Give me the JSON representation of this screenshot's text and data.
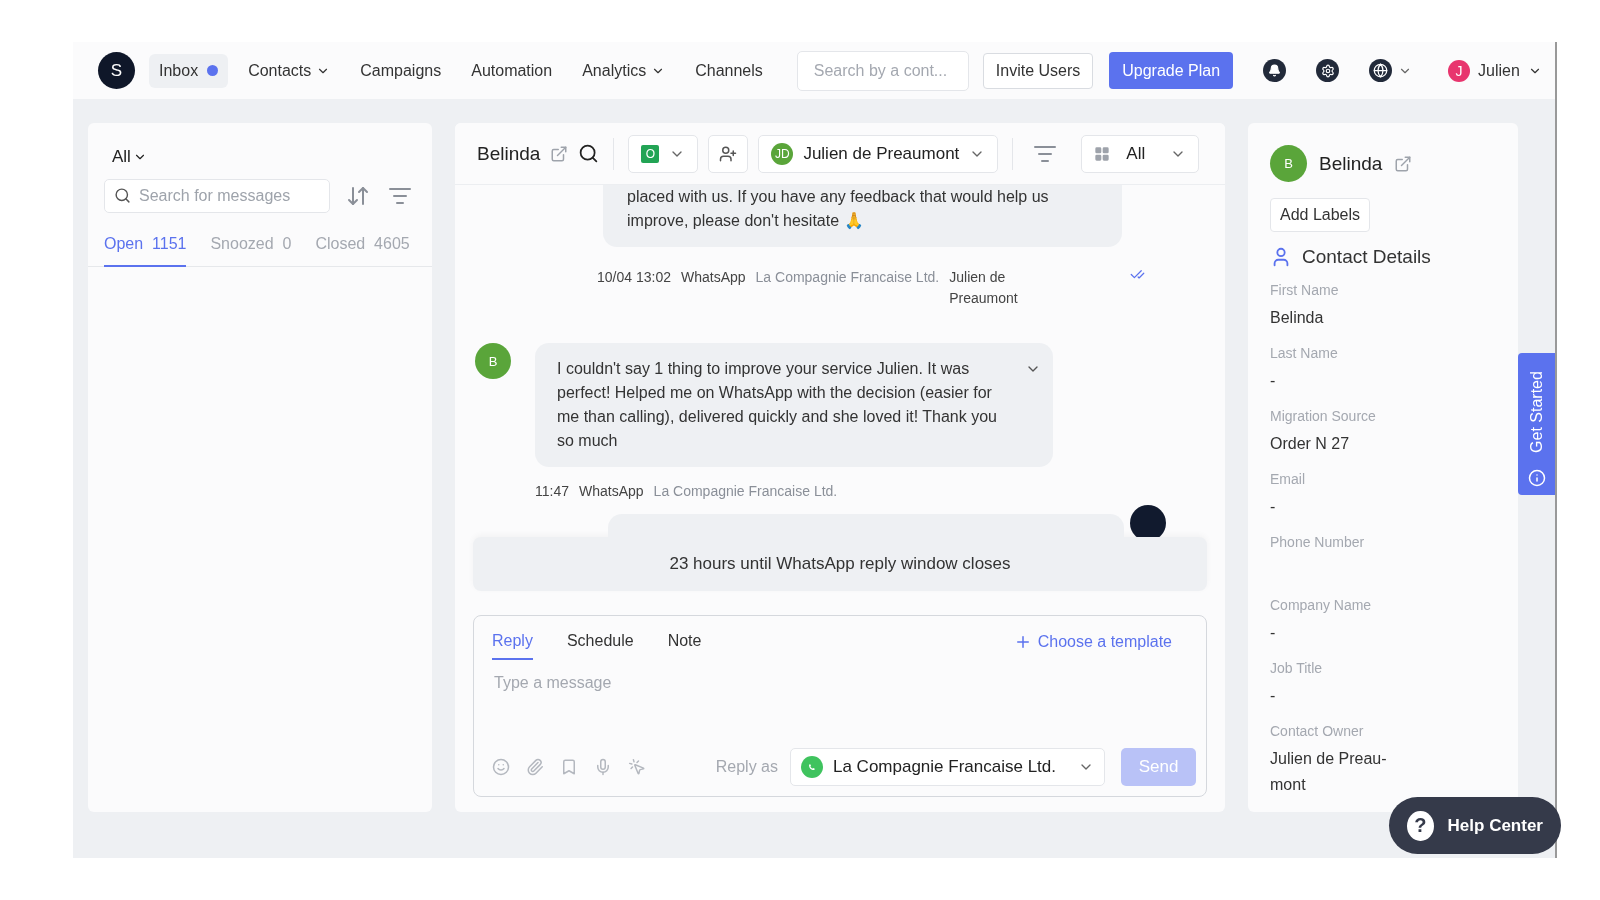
{
  "nav": {
    "logo": "S",
    "items": [
      {
        "label": "Inbox",
        "selected": true,
        "dot": true,
        "dropdown": false
      },
      {
        "label": "Contacts",
        "selected": false,
        "dot": false,
        "dropdown": true
      },
      {
        "label": "Campaigns",
        "selected": false,
        "dot": false,
        "dropdown": false
      },
      {
        "label": "Automation",
        "selected": false,
        "dot": false,
        "dropdown": false
      },
      {
        "label": "Analytics",
        "selected": false,
        "dot": false,
        "dropdown": true
      },
      {
        "label": "Channels",
        "selected": false,
        "dot": false,
        "dropdown": false
      }
    ],
    "search": {
      "placeholder": "Search by a cont..."
    },
    "invite": "Invite Users",
    "upgrade": "Upgrade Plan",
    "user": {
      "initial": "J",
      "name": "Julien"
    }
  },
  "inbox": {
    "filter": "All",
    "search": {
      "placeholder": "Search for messages"
    },
    "tabs": [
      {
        "label": "Open",
        "count": "1151",
        "selected": true
      },
      {
        "label": "Snoozed",
        "count": "0",
        "selected": false
      },
      {
        "label": "Closed",
        "count": "4605",
        "selected": false
      }
    ]
  },
  "conversation": {
    "contact": "Belinda",
    "status_badge": "O",
    "assignee": {
      "initials": "JD",
      "name": "Julien de Preaumont"
    },
    "view": "All",
    "messages": [
      {
        "kind": "outgoing",
        "text": "placed with us. If you have any feedback that would help us improve, please don't hesitate 🙏",
        "time": "10/04 13:02",
        "channel": "WhatsApp",
        "account": "La Compagnie Francaise Ltd.",
        "agent": "Julien de Preaumont",
        "read": true
      },
      {
        "kind": "incoming",
        "avatar": "B",
        "text": "I couldn't say 1 thing to improve your service Julien. It was perfect! Helped me on WhatsApp with the decision (easier for me than calling), delivered quickly and she loved it! Thank you so much",
        "time": "11:47",
        "channel": "WhatsApp",
        "account": "La Compagnie Francaise Ltd."
      },
      {
        "kind": "outgoing-hidden"
      }
    ],
    "banner": "23 hours until WhatsApp reply window closes",
    "composer": {
      "tabs": [
        {
          "label": "Reply",
          "selected": true
        },
        {
          "label": "Schedule",
          "selected": false
        },
        {
          "label": "Note",
          "selected": false
        }
      ],
      "template": "Choose a template",
      "placeholder": "Type a message",
      "reply_as_label": "Reply as",
      "reply_as": "La Compagnie Francaise Ltd.",
      "send": "Send",
      "send_disabled": true
    }
  },
  "contact": {
    "avatar": "B",
    "name": "Belinda",
    "add_labels": "Add Labels",
    "section": "Contact Details",
    "fields": [
      {
        "label": "First Name",
        "value": "Belinda"
      },
      {
        "label": "Last Name",
        "value": "-"
      },
      {
        "label": "Migration Source",
        "value": "Order N 27"
      },
      {
        "label": "Email",
        "value": "-"
      },
      {
        "label": "Phone Number"
      },
      {
        "label": "Company Name",
        "value": "-"
      },
      {
        "label": "Job Title",
        "value": "-"
      },
      {
        "label": "Contact Owner",
        "value": "Julien de Preau-mont"
      }
    ]
  },
  "get_started": "Get Started",
  "help_icon": "?",
  "help_center": "Help Center"
}
